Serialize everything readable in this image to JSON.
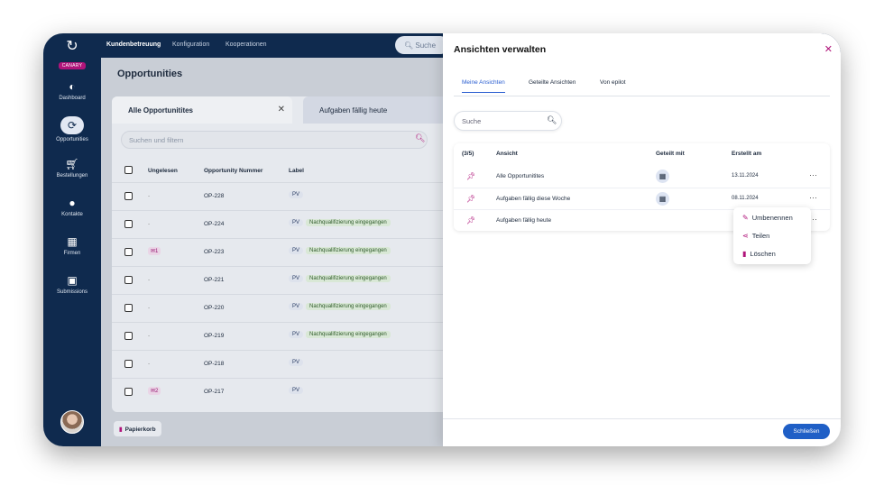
{
  "app": {
    "logo_badge": "CANARY"
  },
  "sidebar": {
    "items": [
      {
        "label": "Dashboard",
        "icon": "pie-chart-icon"
      },
      {
        "label": "Opportunities",
        "icon": "refresh-icon"
      },
      {
        "label": "Bestellungen",
        "icon": "cart-icon"
      },
      {
        "label": "Kontakte",
        "icon": "person-icon"
      },
      {
        "label": "Firmen",
        "icon": "building-icon"
      },
      {
        "label": "Submissions",
        "icon": "inbox-icon"
      }
    ]
  },
  "topnav": {
    "items": [
      "Kundenbetreuung",
      "Konfiguration",
      "Kooperationen"
    ],
    "search_placeholder": "Suche"
  },
  "main": {
    "title": "Opportunities",
    "tabs": [
      "Alle Opportunitites",
      "Aufgaben fällig heute"
    ],
    "filter_placeholder": "Suchen und filtern",
    "columns": [
      "Ungelesen",
      "Opportunity Nummer",
      "Label"
    ],
    "rows": [
      {
        "unread": "-",
        "number": "OP-228",
        "label": "PV",
        "tag": ""
      },
      {
        "unread": "-",
        "number": "OP-224",
        "label": "PV",
        "tag": "Nachqualifizierung eingegangen"
      },
      {
        "unread": "1",
        "number": "OP-223",
        "label": "PV",
        "tag": "Nachqualifizierung eingegangen"
      },
      {
        "unread": "-",
        "number": "OP-221",
        "label": "PV",
        "tag": "Nachqualifizierung eingegangen"
      },
      {
        "unread": "-",
        "number": "OP-220",
        "label": "PV",
        "tag": "Nachqualifizierung eingegangen"
      },
      {
        "unread": "-",
        "number": "OP-219",
        "label": "PV",
        "tag": "Nachqualifizierung eingegangen"
      },
      {
        "unread": "-",
        "number": "OP-218",
        "label": "PV",
        "tag": ""
      },
      {
        "unread": "2",
        "number": "OP-217",
        "label": "PV",
        "tag": ""
      }
    ],
    "trash_label": "Papierkorb"
  },
  "drawer": {
    "title": "Ansichten verwalten",
    "tabs": [
      "Meine Ansichten",
      "Geteilte Ansichten",
      "Von epilot"
    ],
    "search_placeholder": "Suche",
    "table": {
      "count": "(3/5)",
      "headers": [
        "Ansicht",
        "Geteilt mit",
        "Erstellt am"
      ],
      "rows": [
        {
          "name": "Alle Opportunitites",
          "shared": true,
          "date": "13.11.2024"
        },
        {
          "name": "Aufgaben fällig diese Woche",
          "shared": true,
          "date": "08.11.2024"
        },
        {
          "name": "Aufgaben fällig heute",
          "shared": false,
          "date": ""
        }
      ]
    },
    "context_menu": [
      "Umbenennen",
      "Teilen",
      "Löschen"
    ],
    "close_button": "Schließen"
  }
}
